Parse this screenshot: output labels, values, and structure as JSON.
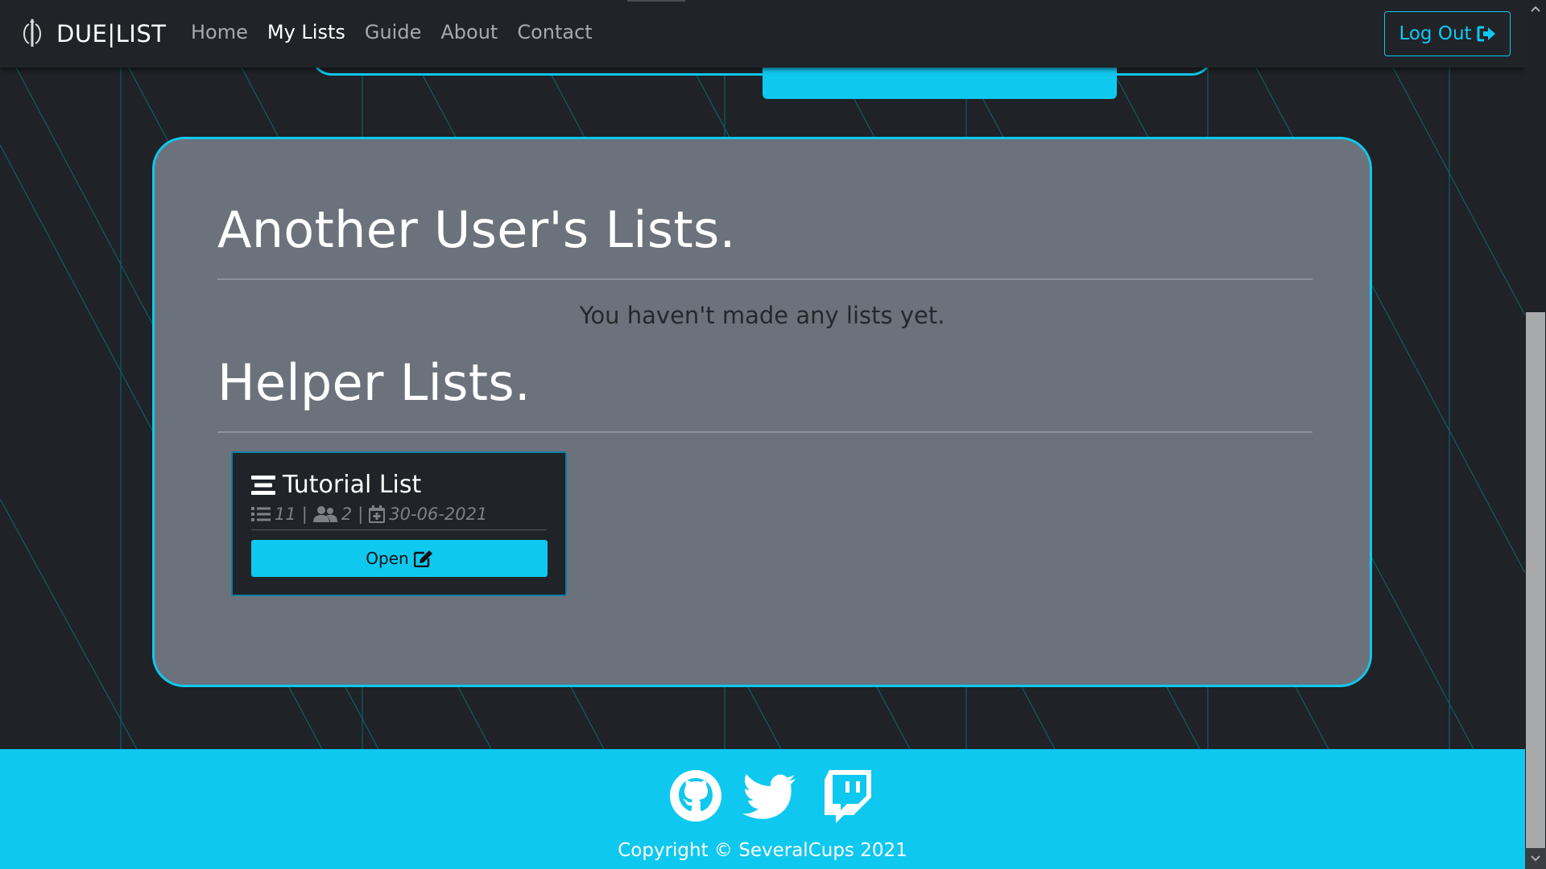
{
  "navbar": {
    "brand": "DUE|LIST",
    "links": [
      {
        "label": "Home",
        "active": false
      },
      {
        "label": "My Lists",
        "active": true
      },
      {
        "label": "Guide",
        "active": false
      },
      {
        "label": "About",
        "active": false
      },
      {
        "label": "Contact",
        "active": false
      }
    ],
    "logout_label": "Log Out",
    "logout_icon": "sign-out-icon"
  },
  "main": {
    "user_section_title": "Another User's Lists.",
    "empty_message": "You haven't made any lists yet.",
    "helper_section_title": "Helper Lists.",
    "lists": [
      {
        "title": "Tutorial List",
        "title_icon": "list-lines-icon",
        "items_count": "11",
        "members_count": "2",
        "date": "30-06-2021",
        "open_label": "Open",
        "open_icon": "edit-icon"
      }
    ]
  },
  "footer": {
    "social": [
      "github-icon",
      "twitter-icon",
      "twitch-icon"
    ],
    "copyright": "Copyright © SeveralCups 2021"
  },
  "colors": {
    "accent": "#0fc8ef",
    "background": "#1f2226",
    "panel": "#6c727b",
    "card": "#202327"
  }
}
